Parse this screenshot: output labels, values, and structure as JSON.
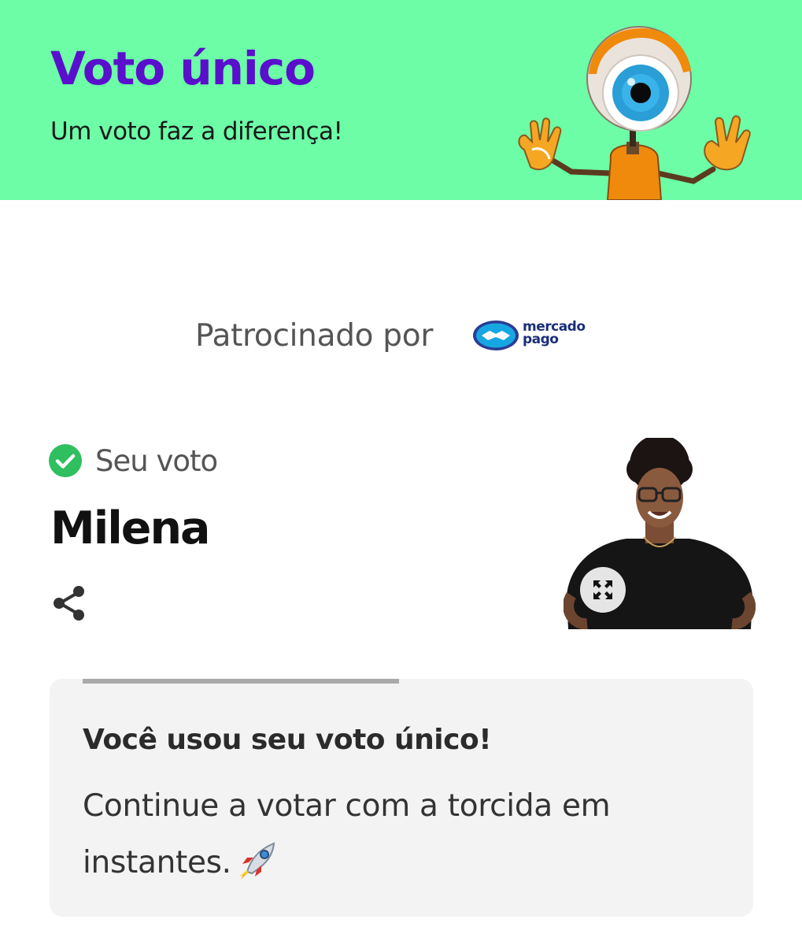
{
  "header": {
    "title": "Voto único",
    "subtitle": "Um voto faz a diferença!"
  },
  "sponsor": {
    "label": "Patrocinado por",
    "logo_line1": "mercado",
    "logo_line2": "pago"
  },
  "vote": {
    "status_label": "Seu voto",
    "candidate_name": "Milena"
  },
  "card": {
    "title": "Você usou seu voto único!",
    "body": "Continue a votar com a torcida em instantes.",
    "progress": 0.45
  },
  "colors": {
    "header_bg": "#6cfda6",
    "title_purple": "#5a0fcc",
    "check_green": "#2fbf5f",
    "card_bg": "#f3f3f3"
  },
  "icons": [
    "bbb-eye-mascot",
    "mercado-pago-logo",
    "check-circle-icon",
    "share-icon",
    "expand-icon",
    "rocket-icon"
  ]
}
